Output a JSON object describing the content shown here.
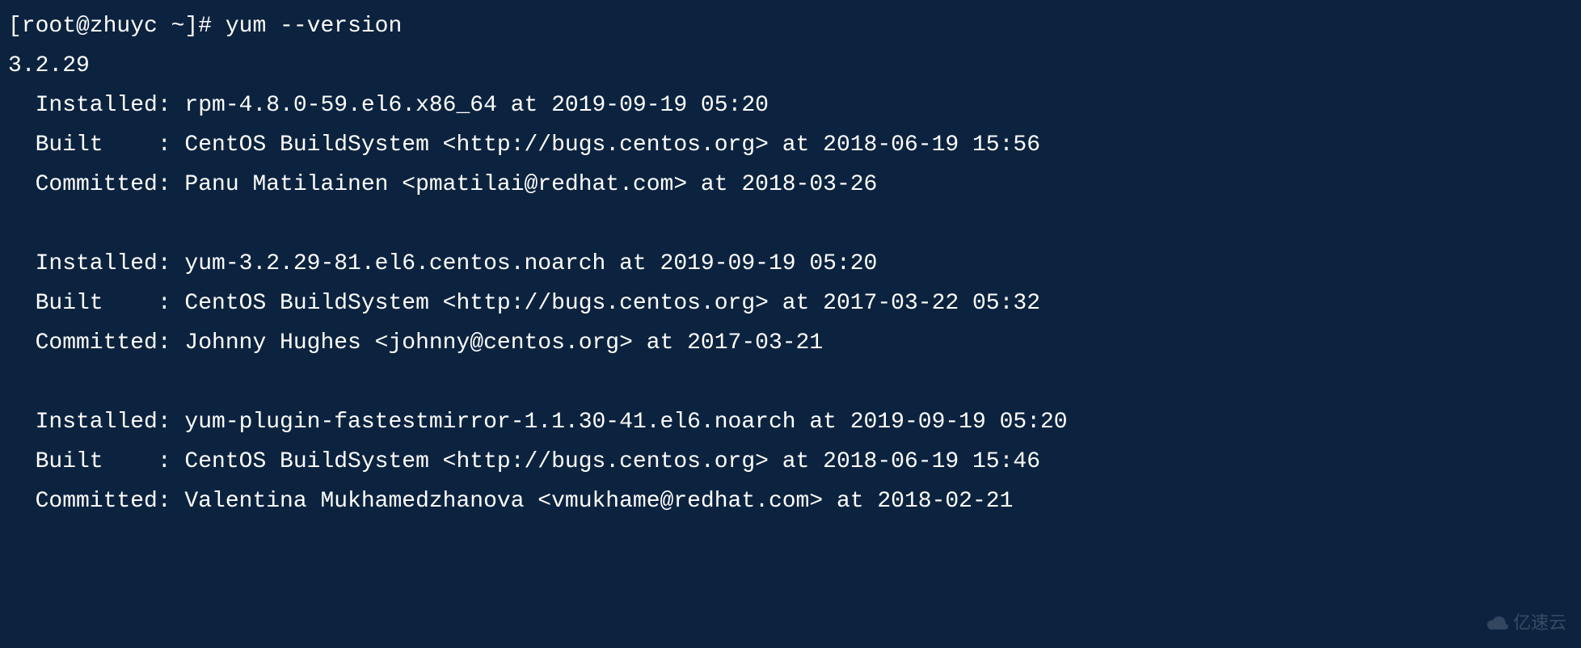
{
  "prompt": "[root@zhuyc ~]# ",
  "command": "yum --version",
  "version": "3.2.29",
  "packages": [
    {
      "installed": "Installed: rpm-4.8.0-59.el6.x86_64 at 2019-09-19 05:20",
      "built": "Built    : CentOS BuildSystem <http://bugs.centos.org> at 2018-06-19 15:56",
      "committed": "Committed: Panu Matilainen <pmatilai@redhat.com> at 2018-03-26"
    },
    {
      "installed": "Installed: yum-3.2.29-81.el6.centos.noarch at 2019-09-19 05:20",
      "built": "Built    : CentOS BuildSystem <http://bugs.centos.org> at 2017-03-22 05:32",
      "committed": "Committed: Johnny Hughes <johnny@centos.org> at 2017-03-21"
    },
    {
      "installed": "Installed: yum-plugin-fastestmirror-1.1.30-41.el6.noarch at 2019-09-19 05:20",
      "built": "Built    : CentOS BuildSystem <http://bugs.centos.org> at 2018-06-19 15:46",
      "committed": "Committed: Valentina Mukhamedzhanova <vmukhame@redhat.com> at 2018-02-21"
    }
  ],
  "watermark": "亿速云"
}
